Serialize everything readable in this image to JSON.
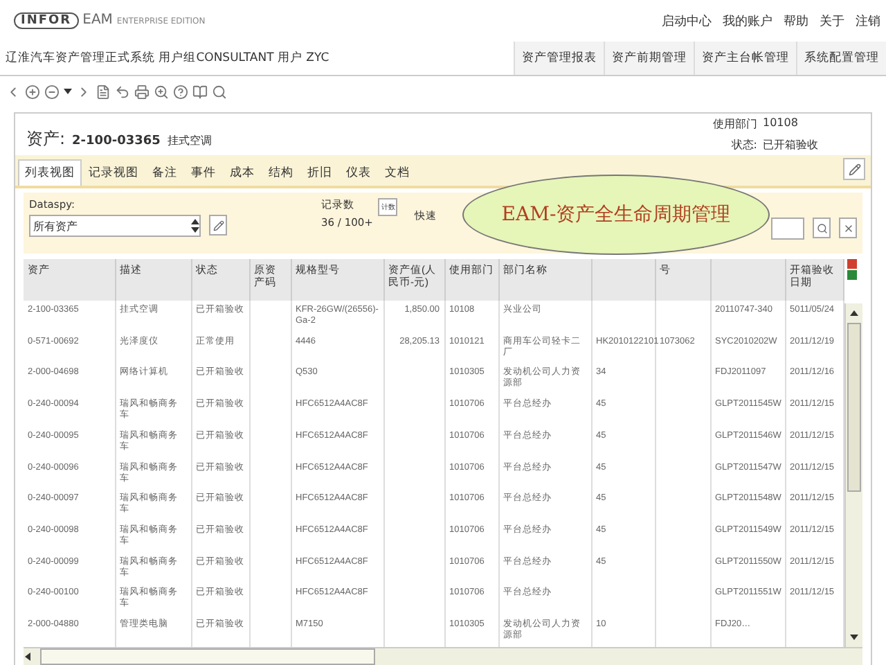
{
  "header": {
    "logo": "INFOR",
    "product": "EAM",
    "edition": "ENTERPRISE EDITION",
    "links": [
      "启动中心",
      "我的账户",
      "帮助",
      "关于",
      "注销"
    ]
  },
  "system_bar": {
    "info": "辽淮汽车资产管理正式系统 用户组CONSULTANT  用户  ZYC",
    "nav": [
      {
        "label": "资产管理报表",
        "selected": false
      },
      {
        "label": "资产前期管理",
        "selected": false
      },
      {
        "label": "资产主台帐管理",
        "selected": false
      },
      {
        "label": "系统配置管理",
        "selected": false
      }
    ]
  },
  "record": {
    "label": "资产:",
    "code": "2-100-03365",
    "description": "挂式空调",
    "fields": [
      {
        "label": "使用部门",
        "value": "10108"
      },
      {
        "label": "状态:",
        "value": "已开箱验收"
      }
    ]
  },
  "tabs": [
    {
      "label": "列表视图",
      "selected": true
    },
    {
      "label": "记录视图",
      "selected": false
    },
    {
      "label": "备注",
      "selected": false
    },
    {
      "label": "事件",
      "selected": false
    },
    {
      "label": "成本",
      "selected": false
    },
    {
      "label": "结构",
      "selected": false
    },
    {
      "label": "折旧",
      "selected": false
    },
    {
      "label": "仪表",
      "selected": false
    },
    {
      "label": "文档",
      "selected": false
    }
  ],
  "filter": {
    "dataspy_label": "Dataspy:",
    "dataspy_value": "所有资产",
    "count_label": "记录数",
    "count_value": "36 / 100+",
    "count_button": "计数",
    "quick_label": "快速"
  },
  "callout": "EAM-资产全生命周期管理",
  "table": {
    "columns": [
      "资产",
      "描述",
      "状态",
      "原资产码",
      "规格型号",
      "资产值(人民币-元)",
      "使用部门",
      "部门名称",
      "",
      "号",
      "",
      "开箱验收日期"
    ],
    "rows": [
      [
        "2-100-03365",
        "挂式空调",
        "已开箱验收",
        "",
        "KFR-26GW/(26556)-Ga-2",
        "1,850.00",
        "10108",
        "兴业公司",
        "",
        "",
        "20110747-340",
        "5011/05/24"
      ],
      [
        "0-571-00692",
        "光泽度仪",
        "正常使用",
        "",
        "4446",
        "28,205.13",
        "1010121",
        "商用车公司轻卡二厂",
        "HK2010122101",
        "1073062",
        "SYC2010202W",
        "2011/12/19"
      ],
      [
        "2-000-04698",
        "网络计算机",
        "已开箱验收",
        "",
        "Q530",
        "",
        "1010305",
        "发动机公司人力资源部",
        "34",
        "",
        "FDJ2011097",
        "2011/12/16"
      ],
      [
        "0-240-00094",
        "瑞风和畅商务车",
        "已开箱验收",
        "",
        "HFC6512A4AC8F",
        "",
        "1010706",
        "平台总经办",
        "45",
        "",
        "GLPT2011545W",
        "2011/12/15"
      ],
      [
        "0-240-00095",
        "瑞风和畅商务车",
        "已开箱验收",
        "",
        "HFC6512A4AC8F",
        "",
        "1010706",
        "平台总经办",
        "45",
        "",
        "GLPT2011546W",
        "2011/12/15"
      ],
      [
        "0-240-00096",
        "瑞风和畅商务车",
        "已开箱验收",
        "",
        "HFC6512A4AC8F",
        "",
        "1010706",
        "平台总经办",
        "45",
        "",
        "GLPT2011547W",
        "2011/12/15"
      ],
      [
        "0-240-00097",
        "瑞风和畅商务车",
        "已开箱验收",
        "",
        "HFC6512A4AC8F",
        "",
        "1010706",
        "平台总经办",
        "45",
        "",
        "GLPT2011548W",
        "2011/12/15"
      ],
      [
        "0-240-00098",
        "瑞风和畅商务车",
        "已开箱验收",
        "",
        "HFC6512A4AC8F",
        "",
        "1010706",
        "平台总经办",
        "45",
        "",
        "GLPT2011549W",
        "2011/12/15"
      ],
      [
        "0-240-00099",
        "瑞风和畅商务车",
        "已开箱验收",
        "",
        "HFC6512A4AC8F",
        "",
        "1010706",
        "平台总经办",
        "45",
        "",
        "GLPT2011550W",
        "2011/12/15"
      ],
      [
        "0-240-00100",
        "瑞风和畅商务车",
        "已开箱验收",
        "",
        "HFC6512A4AC8F",
        "",
        "1010706",
        "平台总经办",
        "",
        "",
        "GLPT2011551W",
        "2011/12/15"
      ],
      [
        "2-000-04880",
        "管理类电脑",
        "已开箱验收",
        "",
        "M7150",
        "",
        "1010305",
        "发动机公司人力资源部",
        "10",
        "",
        "FDJ20…",
        ""
      ]
    ]
  }
}
